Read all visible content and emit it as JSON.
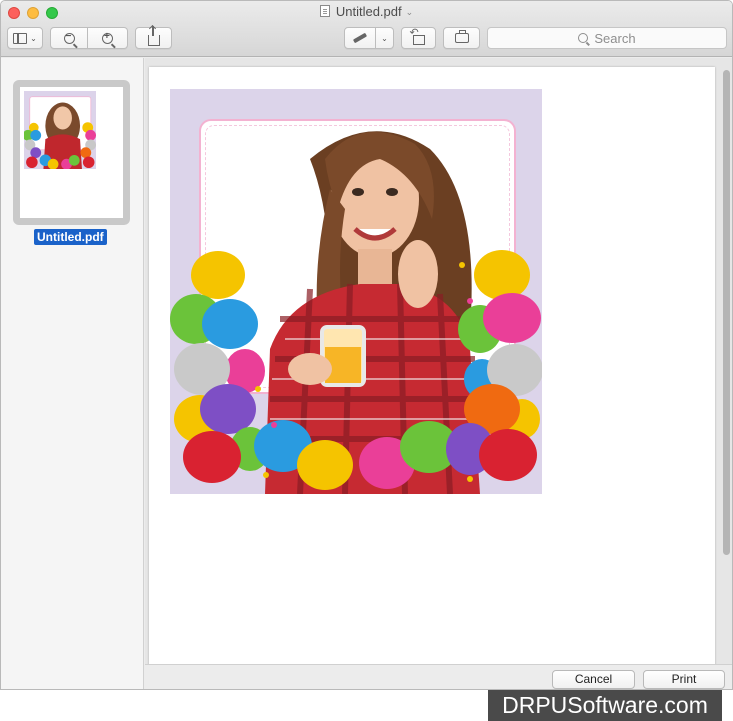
{
  "window": {
    "title": "Untitled.pdf",
    "title_caret": "⌄"
  },
  "toolbar": {
    "sidebar_caret": "⌄",
    "zoom_out_glyph": "−",
    "zoom_in_glyph": "+",
    "markup_caret": "⌄"
  },
  "search": {
    "placeholder": "Search"
  },
  "sidebar": {
    "thumbnail_label": "Untitled.pdf"
  },
  "footer": {
    "cancel_label": "Cancel",
    "print_label": "Print"
  },
  "watermark": {
    "text": "DRPUSoftware.com"
  },
  "colors": {
    "selection": "#1a62c9",
    "card_background": "#dcd4ea",
    "frame_border": "#f3b2d1"
  }
}
